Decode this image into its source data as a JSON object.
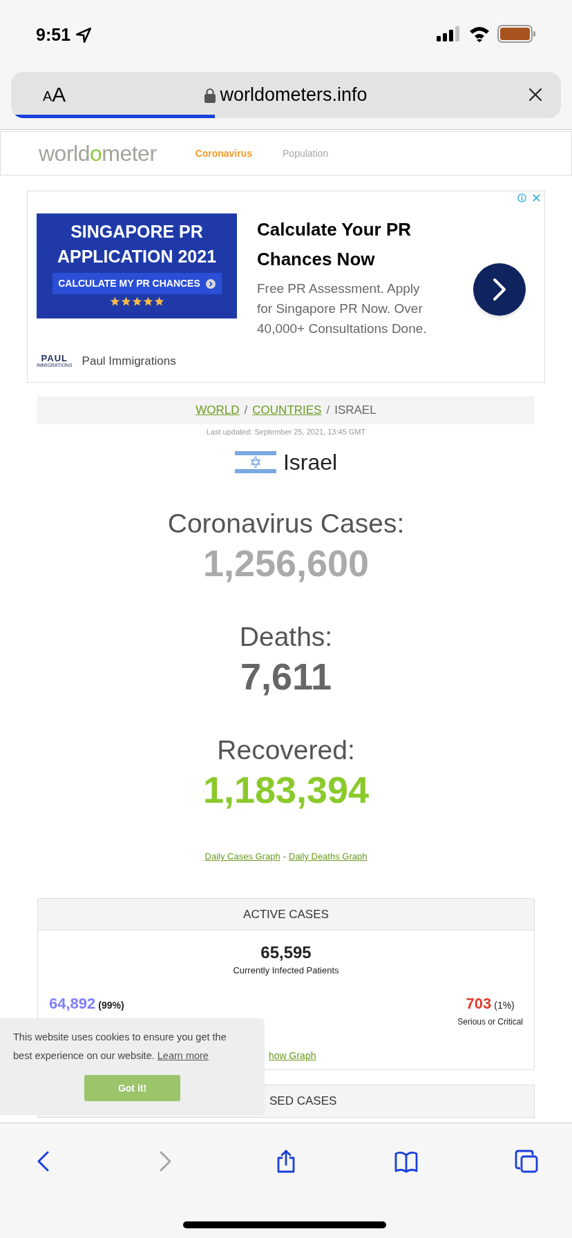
{
  "status_bar": {
    "time": "9:51"
  },
  "browser": {
    "text_size_label": "AA",
    "url": "worldometers.info",
    "progress": {
      "level": 0.37
    }
  },
  "nav": {
    "logo_parts": [
      {
        "text": "world",
        "accent": false
      },
      {
        "text": "o",
        "accent": true
      },
      {
        "text": "meter",
        "accent": false
      }
    ],
    "items": [
      {
        "label": "Coronavirus",
        "selected": true
      },
      {
        "label": "Population",
        "selected": false
      }
    ]
  },
  "ad": {
    "banner_lines": [
      "SINGAPORE PR",
      "APPLICATION 2021"
    ],
    "banner_cta": "CALCULATE MY PR CHANCES",
    "stars": 5,
    "headline": "Calculate Your PR Chances Now",
    "description": "Free PR Assessment. Apply for Singapore PR Now. Over 40,000+ Consultations Done.",
    "advertiser_logo": "PAUL",
    "advertiser_logo_sub": "IMMIGRATIONS",
    "advertiser": "Paul Immigrations"
  },
  "breadcrumb": [
    {
      "kind": "link",
      "text": "WORLD"
    },
    {
      "kind": "separator",
      "text": "/"
    },
    {
      "kind": "link",
      "text": "COUNTRIES"
    },
    {
      "kind": "separator",
      "text": "/"
    },
    {
      "kind": "current",
      "text": "ISRAEL"
    }
  ],
  "last_updated": "Last updated: September 25, 2021, 13:45 GMT",
  "country": "Israel",
  "stats": [
    {
      "label": "Coronavirus Cases:",
      "value": "1,256,600",
      "color": "#aaaaaa"
    },
    {
      "label": "Deaths:",
      "value": "7,611",
      "color": "#666666"
    },
    {
      "label": "Recovered:",
      "value": "1,183,394",
      "color": "#8aca2b"
    }
  ],
  "graph_links": [
    {
      "kind": "link",
      "text": "Daily Cases Graph"
    },
    {
      "kind": "separator",
      "text": "-"
    },
    {
      "kind": "link",
      "text": "Daily Deaths Graph"
    }
  ],
  "active_cases": {
    "header": "ACTIVE CASES",
    "total": "65,595",
    "total_label": "Currently Infected Patients",
    "mild": {
      "value": "64,892",
      "share": "(99%)"
    },
    "critical": {
      "value": "703",
      "share": "(1%)",
      "label": "Serious or Critical"
    },
    "graph_link": "how Graph"
  },
  "closed_cases": {
    "header": "SED CASES"
  },
  "cookie_banner": {
    "text": "This website uses cookies to ensure you get the best experience on our website.",
    "link": "Learn more",
    "button": "Got it!"
  },
  "toolbar": [
    {
      "kind": "back",
      "disabled": false
    },
    {
      "kind": "forward",
      "disabled": true
    },
    {
      "kind": "share",
      "disabled": false
    },
    {
      "kind": "bookmarks",
      "disabled": false
    },
    {
      "kind": "tabs",
      "disabled": false
    }
  ]
}
